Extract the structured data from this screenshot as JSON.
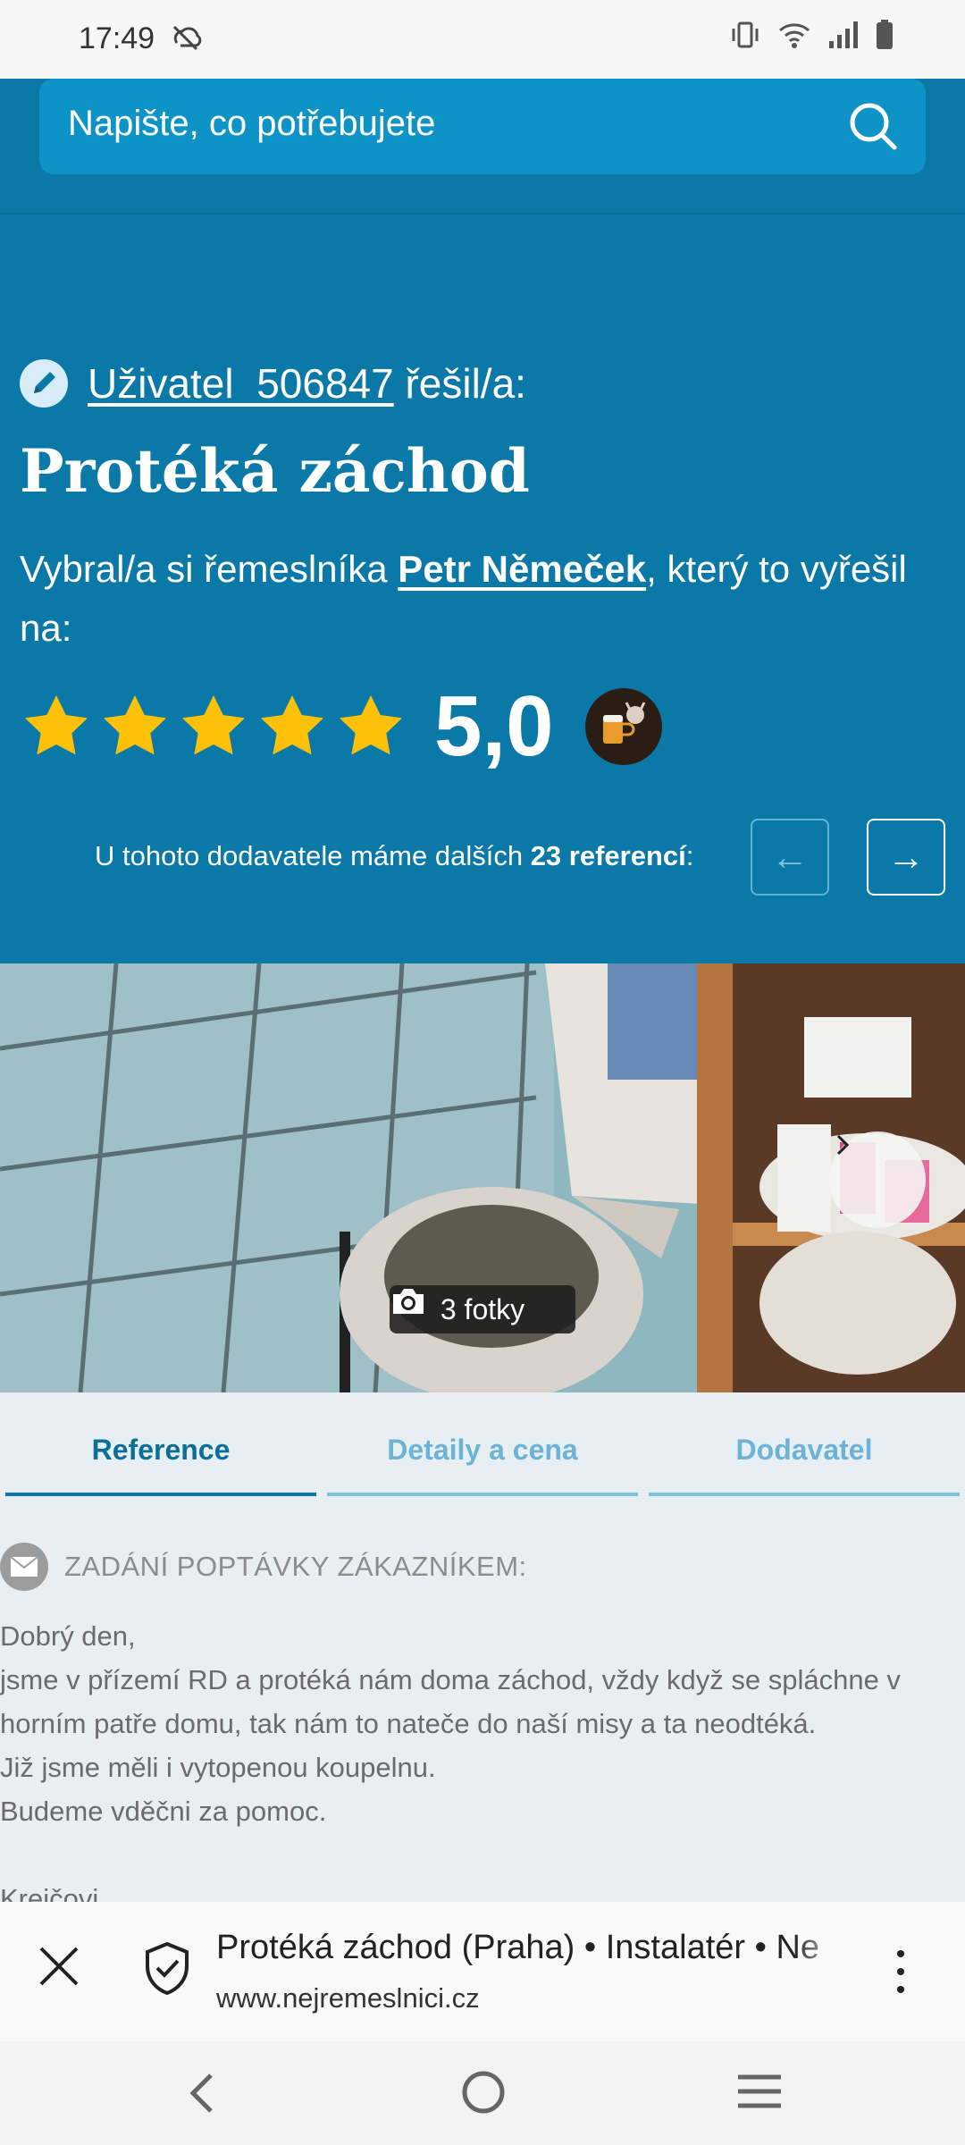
{
  "status_bar": {
    "time": "17:49",
    "icons": [
      "sync-off-icon",
      "vibrate-icon",
      "wifi-icon",
      "signal-icon",
      "battery-icon"
    ]
  },
  "search": {
    "placeholder": "Napište, co potřebujete",
    "icon": "search-icon"
  },
  "hero": {
    "author_name": "Uživatel_506847",
    "author_suffix": " řešil/a:",
    "title": "Protéká záchod",
    "chosen_prefix": "Vybral/a si řemeslníka ",
    "craftsman": "Petr Němeček",
    "chosen_suffix": ", který to vyřešil na:",
    "rating_stars": 5,
    "rating_value": "5,0",
    "refs_prefix": "U tohoto dodavatele máme dalších ",
    "refs_count": "23 referencí",
    "refs_suffix": ":",
    "prev_label": "←",
    "next_label": "→"
  },
  "photo": {
    "count_label": "3 fotky"
  },
  "tabs": [
    {
      "label": "Reference",
      "active": true
    },
    {
      "label": "Detaily a cena",
      "active": false
    },
    {
      "label": "Dodavatel",
      "active": false
    }
  ],
  "request": {
    "label": "ZADÁNÍ POPTÁVKY ZÁKAZNÍKEM:",
    "lines": [
      "Dobrý den,",
      "jsme v přízemí RD a protéká nám doma záchod, vždy když se spláchne v",
      "horním patře domu, tak nám to nateče do naší misy a ta neodtéká.",
      "Již jsme měli i vytopenou koupelnu.",
      "Budeme vděčni za pomoc.",
      "",
      "Krejčovi"
    ]
  },
  "browser": {
    "page_title": "Protéká záchod (Praha) • Instalatér • Ne",
    "domain": "www.nejremeslnici.cz"
  },
  "colors": {
    "brand_blue": "#0b79a7",
    "search_blue": "#0e93c6",
    "star_yellow": "#ffc107",
    "tab_active": "#0b6f99"
  }
}
